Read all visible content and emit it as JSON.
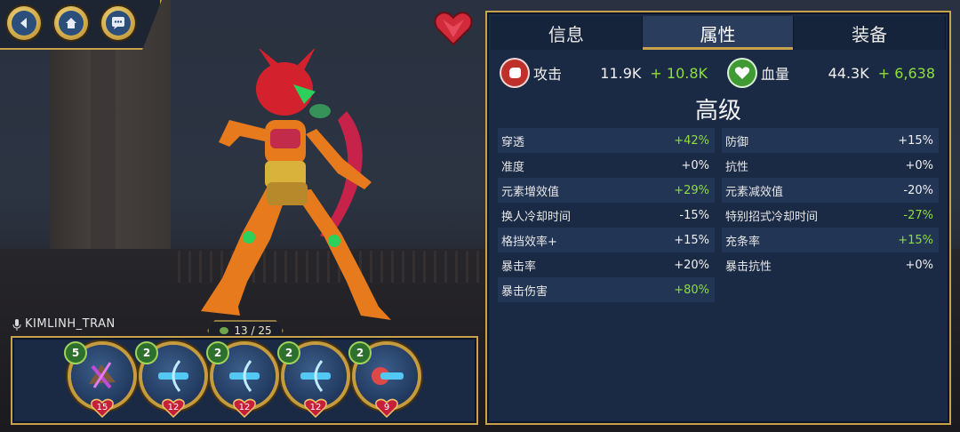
{
  "player": {
    "name": "KIMLINH_TRAN"
  },
  "roster": {
    "counter": "13 / 25",
    "slots": [
      {
        "gear": "5",
        "level": "15",
        "accent": "#c34bd9"
      },
      {
        "gear": "2",
        "level": "12",
        "accent": "#52c8f2"
      },
      {
        "gear": "2",
        "level": "12",
        "accent": "#52c8f2"
      },
      {
        "gear": "2",
        "level": "12",
        "accent": "#52c8f2"
      },
      {
        "gear": "2",
        "level": "9",
        "accent": "#e04848"
      }
    ]
  },
  "tabs": [
    {
      "label": "信息",
      "active": false
    },
    {
      "label": "属性",
      "active": true
    },
    {
      "label": "装备",
      "active": false
    }
  ],
  "summary": {
    "attack": {
      "label": "攻击",
      "base": "11.9K",
      "bonus": "+ 10.8K"
    },
    "health": {
      "label": "血量",
      "base": "44.3K",
      "bonus": "+ 6,638"
    }
  },
  "section_title": "高级",
  "stats": [
    [
      {
        "label": "穿透",
        "value": "+42%",
        "positive": true
      },
      {
        "label": "防御",
        "value": "+15%",
        "positive": false
      }
    ],
    [
      {
        "label": "准度",
        "value": "+0%",
        "positive": false
      },
      {
        "label": "抗性",
        "value": "+0%",
        "positive": false
      }
    ],
    [
      {
        "label": "元素增效值",
        "value": "+29%",
        "positive": true
      },
      {
        "label": "元素减效值",
        "value": "-20%",
        "positive": false
      }
    ],
    [
      {
        "label": "换人冷却时间",
        "value": "-15%",
        "positive": false
      },
      {
        "label": "特别招式冷却时间",
        "value": "-27%",
        "positive": true
      }
    ],
    [
      {
        "label": "格挡效率+",
        "value": "+15%",
        "positive": false
      },
      {
        "label": "充条率",
        "value": "+15%",
        "positive": true
      }
    ],
    [
      {
        "label": "暴击率",
        "value": "+20%",
        "positive": false
      },
      {
        "label": "暴击抗性",
        "value": "+0%",
        "positive": false
      }
    ],
    [
      {
        "label": "暴击伤害",
        "value": "+80%",
        "positive": true
      },
      null
    ]
  ],
  "colors": {
    "gold": "#c7a24a",
    "panel": "#1b2a44",
    "positive": "#8ddf3a",
    "attack_icon": "#c0302a",
    "health_icon": "#3f9a34"
  },
  "icons": [
    "back-icon",
    "home-icon",
    "chat-icon",
    "heart-icon",
    "fist-icon",
    "health-heart-icon",
    "microphone-icon",
    "turtle-icon"
  ]
}
